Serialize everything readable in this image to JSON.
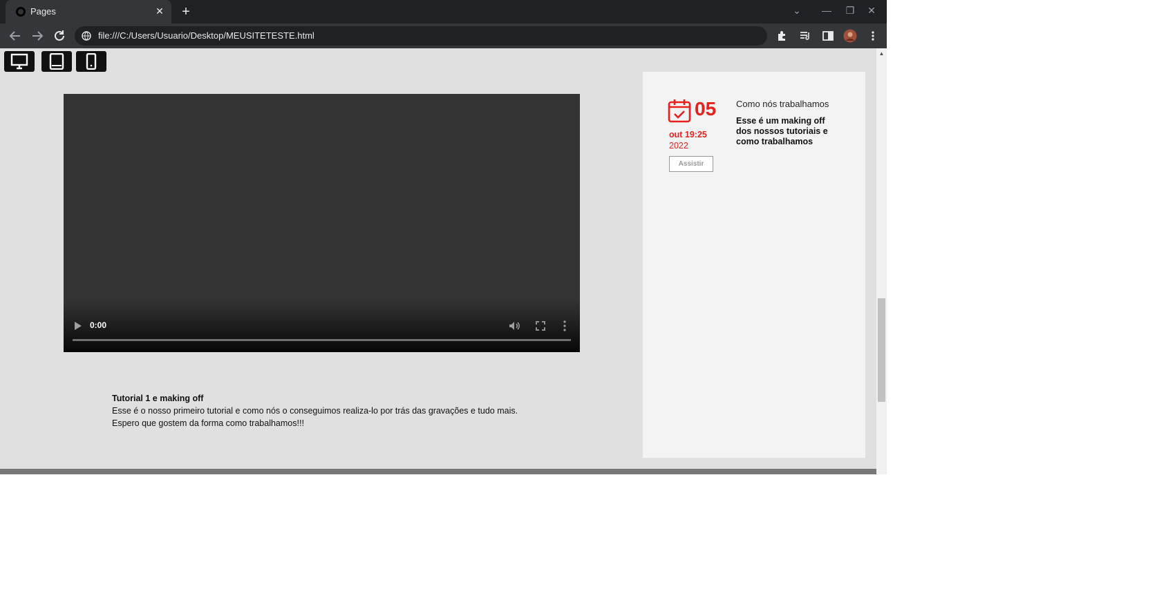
{
  "browser": {
    "tab_title": "Pages",
    "tab_close": "✕",
    "new_tab": "+",
    "url": "file:///C:/Users/Usuario/Desktop/MEUSITETESTE.html",
    "window_controls": {
      "tab_search": "⌄",
      "minimize": "—",
      "restore": "❐",
      "close": "✕"
    }
  },
  "device_switcher": {
    "buttons": [
      {
        "icon": "desktop-icon"
      },
      {
        "icon": "tablet-icon"
      },
      {
        "icon": "mobile-icon"
      }
    ]
  },
  "video": {
    "time": "0:00",
    "progress": 0
  },
  "caption": {
    "title": "Tutorial 1 e making off",
    "line1": "Esse é o nosso primeiro tutorial e como nós o conseguimos realiza-lo por trás das gravações e tudo mais.",
    "line2": "Espero que gostem da forma como trabalhamos!!!"
  },
  "event": {
    "day": "05",
    "month_time": "out 19:25",
    "year": "2022",
    "button": "Assistir",
    "title": "Como nós trabalhamos",
    "description": "Esse é um making off dos nossos tutoriais e como trabalhamos"
  },
  "colors": {
    "accent": "#e8201b",
    "page_bg": "#e0e0e0",
    "panel_bg": "#f3f3f3",
    "browser_frame": "#202124"
  }
}
